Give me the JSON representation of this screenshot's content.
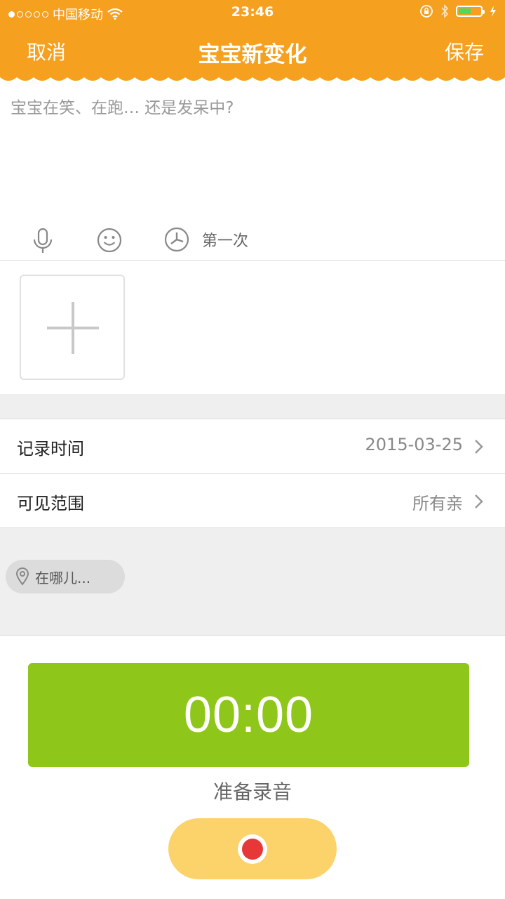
{
  "status_bar": {
    "carrier": "中国移动",
    "time": "23:46",
    "battery_level": 0.55,
    "signal_bars_filled": 1,
    "signal_bars_total": 5
  },
  "nav": {
    "cancel_label": "取消",
    "title": "宝宝新变化",
    "save_label": "保存"
  },
  "note": {
    "placeholder": "宝宝在笑、在跑… 还是发呆中?",
    "value": ""
  },
  "tools": {
    "first_time_label": "第一次",
    "icons": [
      "microphone-icon",
      "smiley-icon",
      "first-time-icon"
    ]
  },
  "settings": [
    {
      "label": "记录时间",
      "value": "2015-03-25"
    },
    {
      "label": "可见范围",
      "value": "所有亲"
    }
  ],
  "location": {
    "placeholder": "在哪儿..."
  },
  "recorder": {
    "timer": "00:00",
    "status": "准备录音"
  },
  "colors": {
    "brand_orange": "#f6a020",
    "timer_green": "#8fc61a",
    "record_button": "#fcd36a",
    "record_dot": "#e73737",
    "battery_green": "#4cd964"
  }
}
